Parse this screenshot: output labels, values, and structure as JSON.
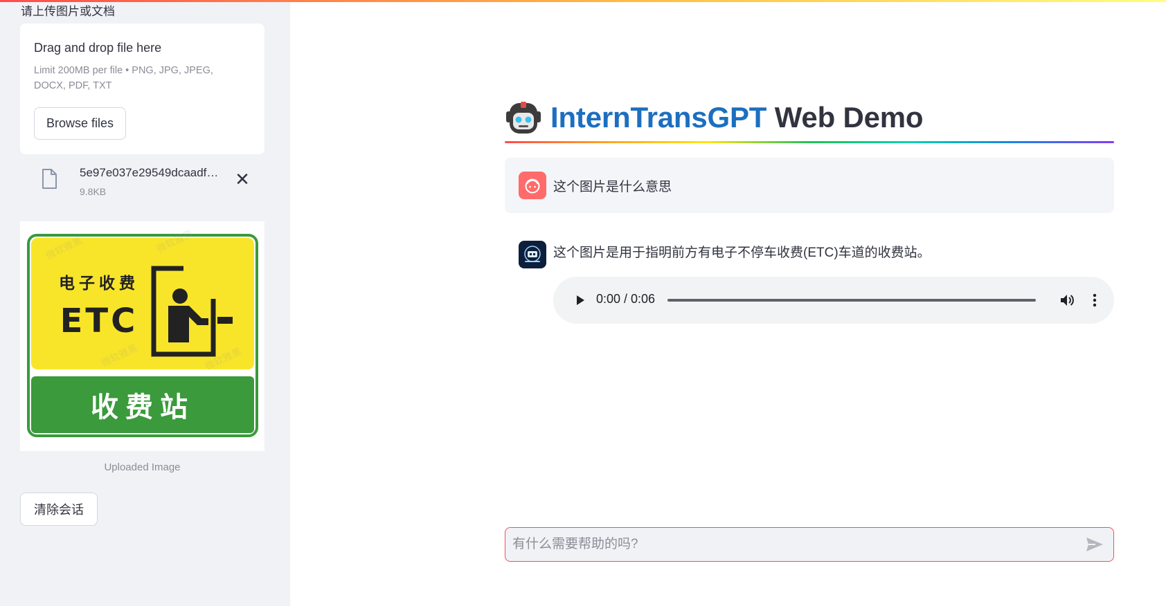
{
  "sidebar": {
    "uploader_label": "请上传图片或文档",
    "dropzone": {
      "title": "Drag and drop file here",
      "limit": "Limit 200MB per file • PNG, JPG, JPEG, DOCX, PDF, TXT",
      "browse_label": "Browse files"
    },
    "file": {
      "name": "5e97e037e29549dcaadf…",
      "size": "9.8KB",
      "icon": "file-icon",
      "remove_icon": "close-icon"
    },
    "image": {
      "top_line1": "电子收费",
      "top_line2": "ETC",
      "bottom_text": "收费站",
      "watermark": "微软雅黑"
    },
    "image_caption": "Uploaded Image",
    "clear_label": "清除会话"
  },
  "main": {
    "title_brand": "InternTransGPT",
    "title_rest": " Web Demo",
    "title_icon": "robot-icon",
    "messages": [
      {
        "role": "user",
        "avatar": "user-avatar-icon",
        "text": "这个图片是什么意思"
      },
      {
        "role": "assistant",
        "avatar": "assistant-avatar-icon",
        "text": "这个图片是用于指明前方有电子不停车收费(ETC)车道的收费站。"
      }
    ],
    "audio": {
      "time": "0:00 / 0:06",
      "progress": 0
    },
    "chat_input": {
      "placeholder": "有什么需要帮助的吗?",
      "value": ""
    }
  },
  "colors": {
    "accent": "#ff4b4b",
    "brand_blue": "#1c6fbf",
    "sidebar_bg": "#f0f2f6",
    "sign_yellow": "#f8e52a",
    "sign_green": "#3a9a3c"
  }
}
